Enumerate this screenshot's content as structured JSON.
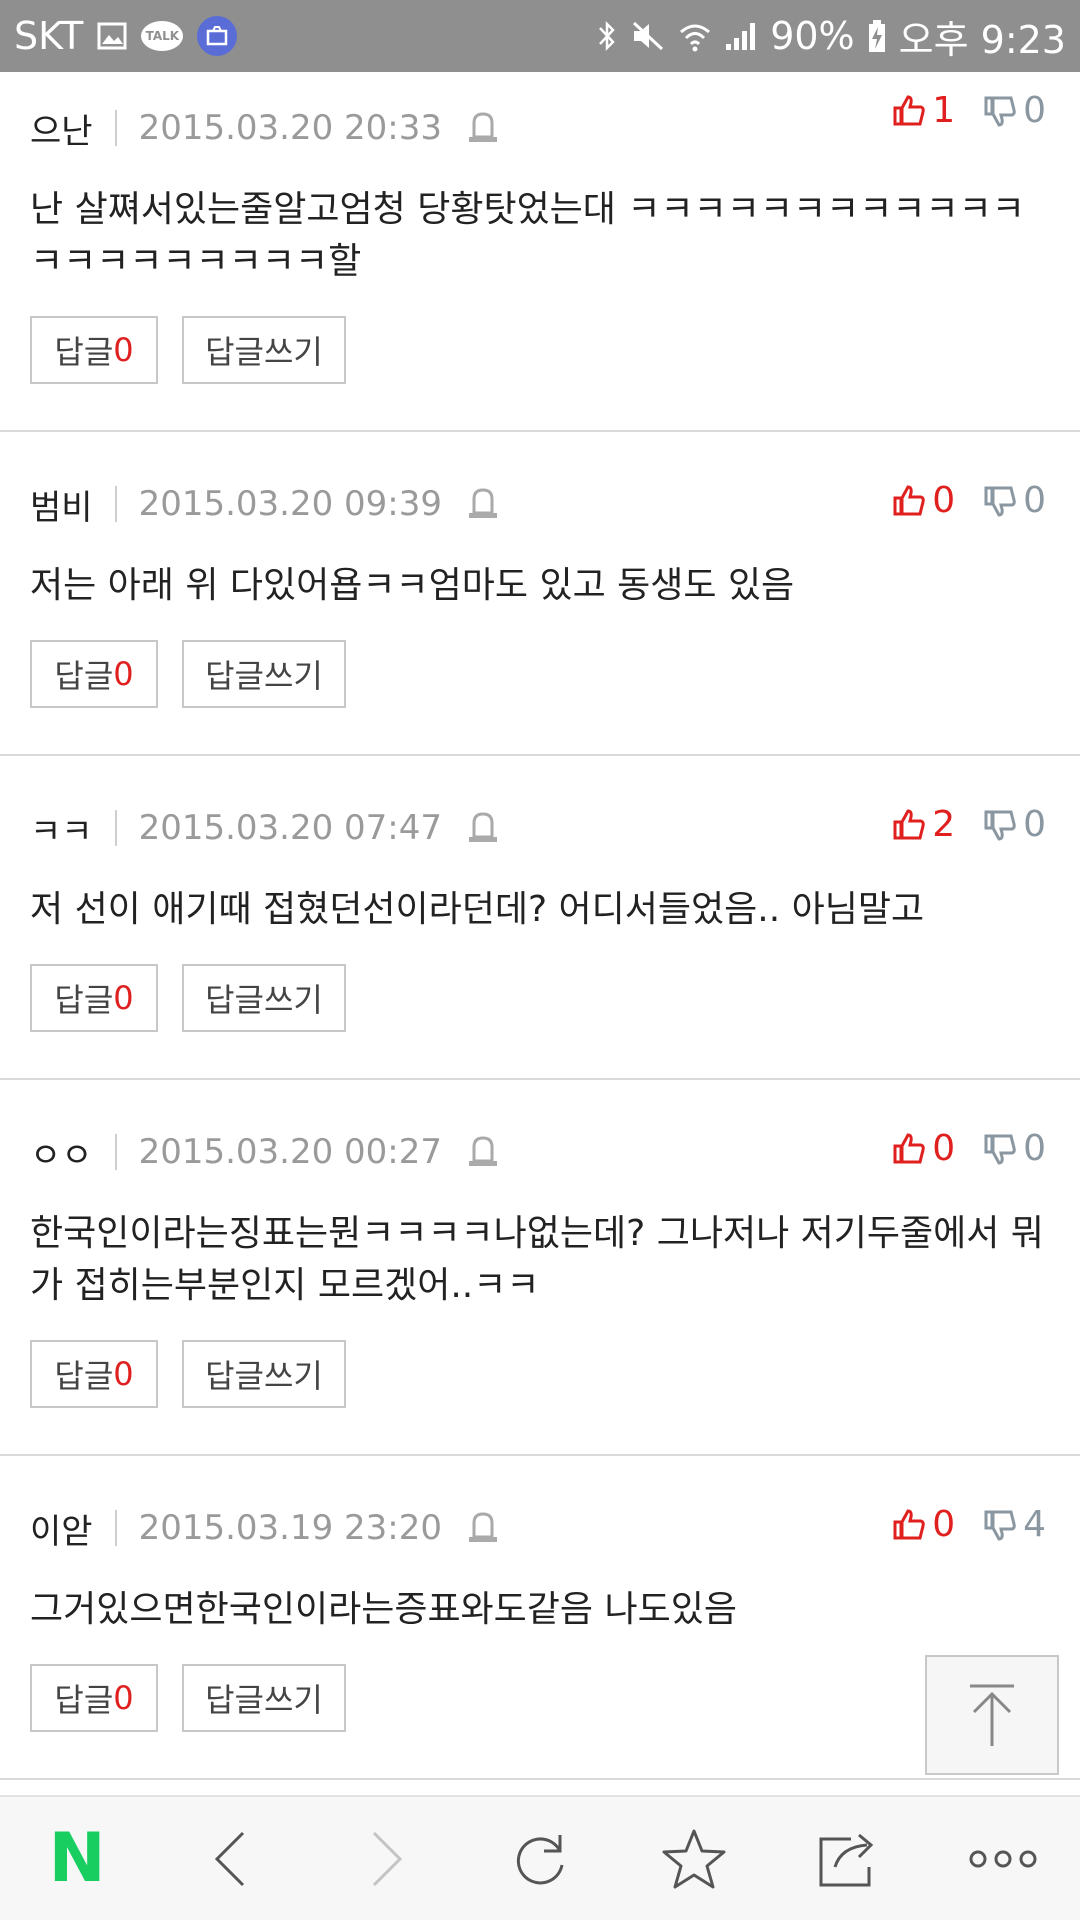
{
  "status_bar": {
    "carrier": "SKT",
    "talk_label": "TALK",
    "battery": "90%",
    "time": "오후 9:23"
  },
  "comments": [
    {
      "author": "으난",
      "date": "2015.03.20 20:33",
      "up": "1",
      "down": "0",
      "body": "난 살쪄서있는줄알고엄청 당황탓었는대 ㅋㅋㅋㅋㅋㅋㅋㅋㅋㅋㅋㅋㅋㅋㅋㅋㅋㅋㅋㅋㅋ할",
      "reply_label": "답글",
      "reply_count": "0",
      "write_label": "답글쓰기"
    },
    {
      "author": "범비",
      "date": "2015.03.20 09:39",
      "up": "0",
      "down": "0",
      "body": "저는 아래 위 다있어욥ㅋㅋ엄마도 있고 동생도 있음",
      "reply_label": "답글",
      "reply_count": "0",
      "write_label": "답글쓰기"
    },
    {
      "author": "ㅋㅋ",
      "date": "2015.03.20 07:47",
      "up": "2",
      "down": "0",
      "body": "저 선이 애기때 접혔던선이라던데? 어디서들었음.. 아님말고",
      "reply_label": "답글",
      "reply_count": "0",
      "write_label": "답글쓰기"
    },
    {
      "author": "ㅇㅇ",
      "date": "2015.03.20 00:27",
      "up": "0",
      "down": "0",
      "body": "한국인이라는징표는뭔ㅋㅋㅋㅋ나없는데? 그나저나 저기두줄에서 뭐가 접히는부분인지 모르겠어..ㅋㅋ",
      "reply_label": "답글",
      "reply_count": "0",
      "write_label": "답글쓰기"
    },
    {
      "author": "이앋",
      "date": "2015.03.19 23:20",
      "up": "0",
      "down": "4",
      "body": "그거있으면한국인이라는증표와도같음 나도있음",
      "reply_label": "답글",
      "reply_count": "0",
      "write_label": "답글쓰기"
    }
  ],
  "toolbar": {
    "home_letter": "N",
    "home_color": "#19ce60"
  },
  "colors": {
    "accent_red": "#e0201e",
    "status_bar": "#8f8f8f"
  }
}
